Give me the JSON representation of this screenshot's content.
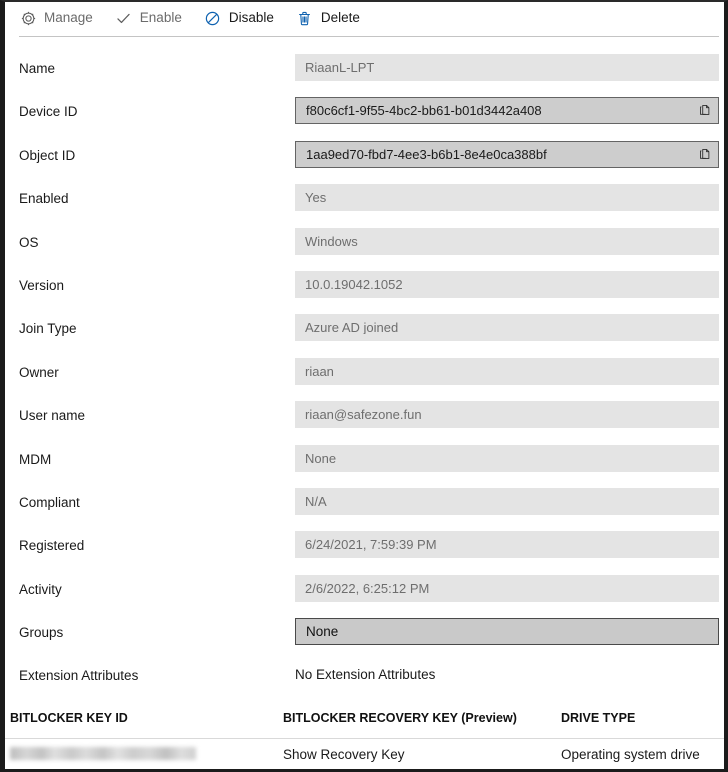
{
  "toolbar": {
    "items": [
      {
        "label": "Manage",
        "icon": "gear-icon",
        "name": "toolbar-manage",
        "state": "disabled"
      },
      {
        "label": "Enable",
        "icon": "checkmark-icon",
        "name": "toolbar-enable",
        "state": "disabled"
      },
      {
        "label": "Disable",
        "icon": "block-icon",
        "name": "toolbar-disable",
        "state": "enabled"
      },
      {
        "label": "Delete",
        "icon": "trash-icon",
        "name": "toolbar-delete",
        "state": "enabled"
      }
    ]
  },
  "properties": [
    {
      "label": "Name",
      "value": "RiaanL-LPT",
      "style": "plain",
      "copy": false,
      "name": "field-name"
    },
    {
      "label": "Device ID",
      "value": "f80c6cf1-9f55-4bc2-bb61-b01d3442a408",
      "style": "copy",
      "copy": true,
      "name": "field-device-id"
    },
    {
      "label": "Object ID",
      "value": "1aa9ed70-fbd7-4ee3-b6b1-8e4e0ca388bf",
      "style": "copy",
      "copy": true,
      "name": "field-object-id"
    },
    {
      "label": "Enabled",
      "value": "Yes",
      "style": "plain",
      "copy": false,
      "name": "field-enabled"
    },
    {
      "label": "OS",
      "value": "Windows",
      "style": "plain",
      "copy": false,
      "name": "field-os"
    },
    {
      "label": "Version",
      "value": "10.0.19042.1052",
      "style": "plain",
      "copy": false,
      "name": "field-version"
    },
    {
      "label": "Join Type",
      "value": "Azure AD joined",
      "style": "plain",
      "copy": false,
      "name": "field-join-type"
    },
    {
      "label": "Owner",
      "value": "riaan",
      "style": "plain",
      "copy": false,
      "name": "field-owner"
    },
    {
      "label": "User name",
      "value": "riaan@safezone.fun",
      "style": "plain",
      "copy": false,
      "name": "field-user-name"
    },
    {
      "label": "MDM",
      "value": "None",
      "style": "plain",
      "copy": false,
      "name": "field-mdm"
    },
    {
      "label": "Compliant",
      "value": "N/A",
      "style": "plain",
      "copy": false,
      "name": "field-compliant"
    },
    {
      "label": "Registered",
      "value": "6/24/2021, 7:59:39 PM",
      "style": "plain",
      "copy": false,
      "name": "field-registered"
    },
    {
      "label": "Activity",
      "value": "2/6/2022, 6:25:12 PM",
      "style": "plain",
      "copy": false,
      "name": "field-activity"
    },
    {
      "label": "Groups",
      "value": "None",
      "style": "selected",
      "copy": false,
      "name": "field-groups"
    },
    {
      "label": "Extension Attributes",
      "value": "No Extension Attributes",
      "style": "bare",
      "copy": false,
      "name": "field-extension-attributes"
    }
  ],
  "bitlocker": {
    "columns": [
      "BITLOCKER KEY ID",
      "BITLOCKER RECOVERY KEY (Preview)",
      "DRIVE TYPE"
    ],
    "rows": [
      {
        "key_id": "",
        "key_id_redacted": true,
        "recovery_key_link": "Show Recovery Key",
        "drive_type": "Operating system drive"
      }
    ]
  },
  "colors": {
    "link": "#0d5ba8",
    "icon_blue": "#0f62b0",
    "icon_gray": "#5e5e5e",
    "field_bg": "#e4e4e4",
    "field_copy_bg": "#cdcdcd",
    "field_selected_bg": "#c9c9c9"
  }
}
